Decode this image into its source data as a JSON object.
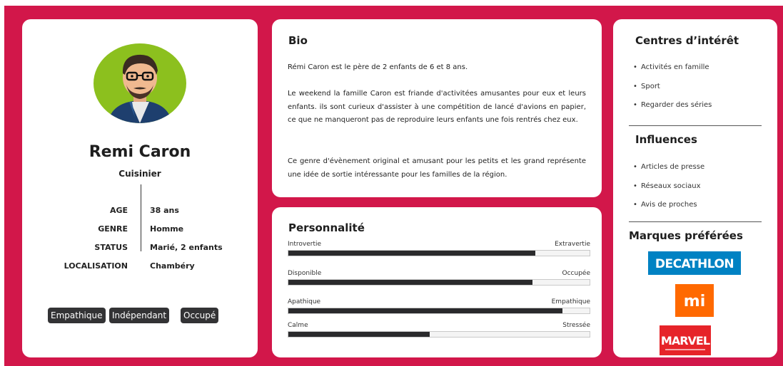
{
  "profile": {
    "name": "Remi Caron",
    "role": "Cuisinier",
    "facts": [
      {
        "label": "AGE",
        "value": "38 ans"
      },
      {
        "label": "GENRE",
        "value": "Homme"
      },
      {
        "label": "STATUS",
        "value": "Marié, 2 enfants"
      },
      {
        "label": "LOCALISATION",
        "value": "Chambéry"
      }
    ],
    "tags": [
      "Empathique",
      "Indépendant",
      "Occupé"
    ],
    "avatar_bg_color": "#8cc01e"
  },
  "bio": {
    "title": "Bio",
    "paragraphs": [
      "Rémi Caron est le père de 2 enfants de 6 et 8 ans.",
      "Le weekend la famille Caron est friande d'activitées amusantes pour eux et leurs enfants. ils sont curieux d'assister à une compétition de lancé d'avions en papier, ce que ne manqueront pas de reproduire leurs enfants une fois rentrés chez eux.",
      "Ce genre d'évènement original et amusant pour les petits et les grand représente une idée de sortie intéressante pour les familles de la région."
    ]
  },
  "personality": {
    "title": "Personnalité",
    "traits": [
      {
        "left": "Introvertie",
        "right": "Extravertie",
        "value": 0.82
      },
      {
        "left": "Disponible",
        "right": "Occupée",
        "value": 0.81
      },
      {
        "left": "Apathique",
        "right": "Empathique",
        "value": 0.91
      },
      {
        "left": "Calme",
        "right": "Stressée",
        "value": 0.47
      }
    ]
  },
  "interests": {
    "title": "Centres d’intérêt",
    "items": [
      "Activités en famille",
      "Sport",
      "Regarder des séries"
    ]
  },
  "influences": {
    "title": "Influences",
    "items": [
      "Articles de presse",
      "Réseaux sociaux",
      "Avis de proches"
    ]
  },
  "brands": {
    "title": "Marques préférées",
    "items": [
      "DECATHLON",
      "mi",
      "MARVEL"
    ],
    "colors": {
      "decathlon": "#0082c3",
      "mi": "#ff6900",
      "marvel": "#e62429"
    }
  },
  "colors": {
    "frame": "#d2174a",
    "bar_fill": "#2a2a2c",
    "tag_bg": "#333335"
  }
}
